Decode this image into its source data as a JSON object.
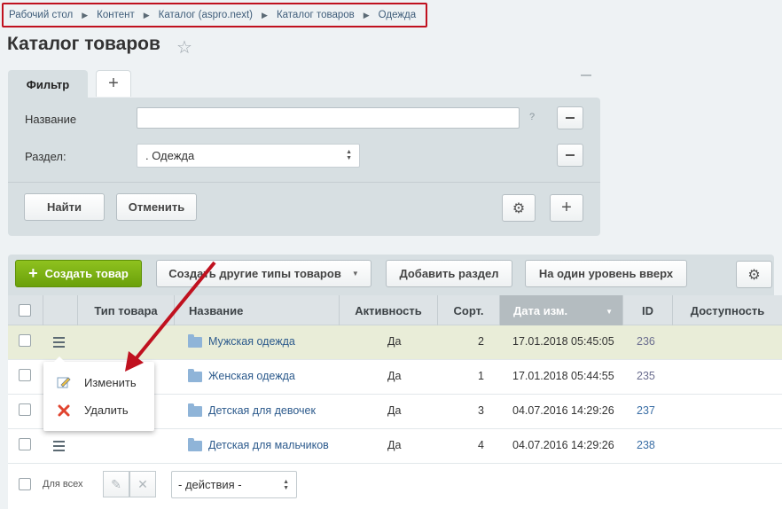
{
  "breadcrumb": [
    "Рабочий стол",
    "Контент",
    "Каталог (aspro.next)",
    "Каталог товаров",
    "Одежда"
  ],
  "page_title": "Каталог товаров",
  "filter": {
    "tab_label": "Фильтр",
    "name_label": "Название",
    "name_value": "",
    "section_label": "Раздел:",
    "section_value": ". Одежда",
    "hint": "?",
    "find_label": "Найти",
    "cancel_label": "Отменить"
  },
  "toolbar": {
    "create_label": "Создать товар",
    "other_types_label": "Создать другие типы товаров",
    "add_section_label": "Добавить раздел",
    "level_up_label": "На один уровень вверх"
  },
  "table": {
    "columns": [
      "Тип товара",
      "Название",
      "Активность",
      "Сорт.",
      "Дата изм.",
      "ID",
      "Доступность"
    ],
    "rows": [
      {
        "name": "Мужская одежда",
        "active": "Да",
        "sort": "2",
        "date": "17.01.2018 05:45:05",
        "id": "236"
      },
      {
        "name": "Женская одежда",
        "active": "Да",
        "sort": "1",
        "date": "17.01.2018 05:44:55",
        "id": "235"
      },
      {
        "name": "Детская для девочек",
        "active": "Да",
        "sort": "3",
        "date": "04.07.2016 14:29:26",
        "id": "237"
      },
      {
        "name": "Детская для мальчиков",
        "active": "Да",
        "sort": "4",
        "date": "04.07.2016 14:29:26",
        "id": "238"
      }
    ]
  },
  "context_menu": {
    "edit_label": "Изменить",
    "delete_label": "Удалить"
  },
  "footer": {
    "for_all_label": "Для всех",
    "actions_value": "- действия -"
  },
  "colors": {
    "accent_green": "#7ab317",
    "highlight_border": "#c0111f",
    "selected_row": "#e9edd8",
    "arrow": "#c0111f"
  }
}
